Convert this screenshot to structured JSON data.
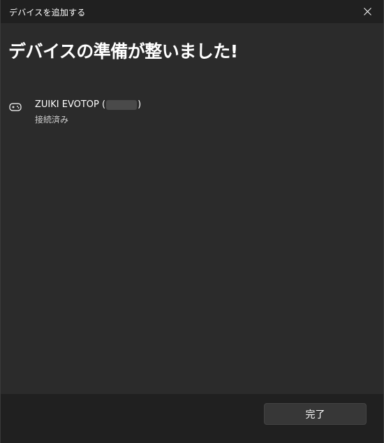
{
  "window": {
    "title": "デバイスを追加する"
  },
  "main": {
    "heading": "デバイスの準備が整いました!",
    "device": {
      "icon": "gamepad-icon",
      "name_prefix": "ZUIKI EVOTOP (",
      "name_suffix": ")",
      "status": "接続済み"
    }
  },
  "footer": {
    "done_label": "完了"
  },
  "colors": {
    "titlebar_bg": "#202020",
    "content_bg": "#2b2b2b",
    "button_bg": "#373737",
    "text": "#ffffff"
  }
}
